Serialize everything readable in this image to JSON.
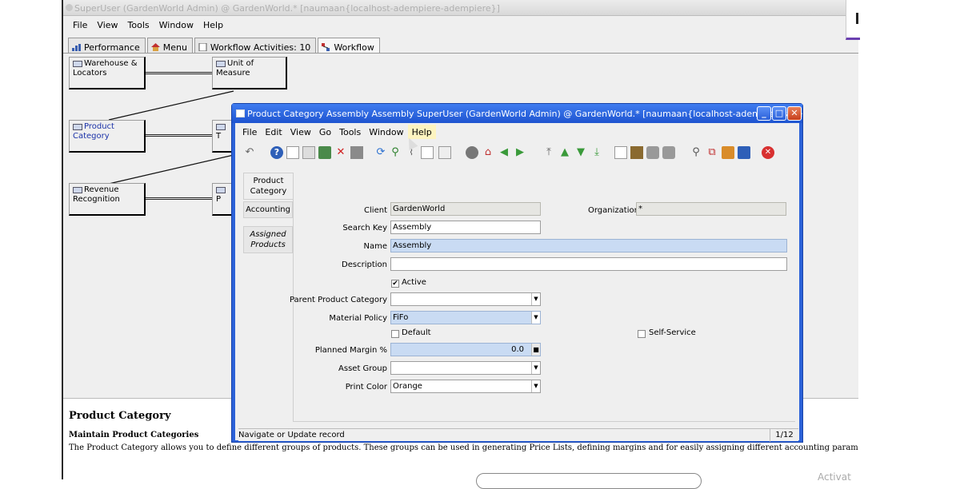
{
  "main_window": {
    "title": "SuperUser  (GardenWorld Admin)  @ GardenWorld.* [naumaan{localhost-adempiere-adempiere}]",
    "menu": [
      "File",
      "View",
      "Tools",
      "Window",
      "Help"
    ],
    "tabs": [
      {
        "label": "Performance",
        "icon": "chart-icon"
      },
      {
        "label": "Menu",
        "icon": "home-icon"
      },
      {
        "label": "Workflow Activities: 10",
        "icon": "document-icon"
      },
      {
        "label": "Workflow",
        "icon": "workflow-icon"
      }
    ]
  },
  "workflow": {
    "nodes": [
      {
        "label": "Warehouse & Locators"
      },
      {
        "label": "Unit of Measure"
      },
      {
        "label": "Product Category"
      },
      {
        "label": "T"
      },
      {
        "label": "Revenue Recognition"
      },
      {
        "label": "P"
      }
    ]
  },
  "help_panel": {
    "title": "Product Category",
    "subtitle": "Maintain Product Categories",
    "text": "The Product Category allows you to define different groups of products.  These groups can be used in generating Price Lists, defining margins and for easily assigning different accounting parameters for products."
  },
  "dialog": {
    "title": "Product Category  Assembly  Assembly  SuperUser  (GardenWorld Admin)  @ GardenWorld.* [naumaan{localhost-adempiere-ade...",
    "menu": [
      "File",
      "Edit",
      "View",
      "Go",
      "Tools",
      "Window",
      "Help"
    ],
    "side_tabs": [
      "Product Category",
      "Accounting",
      "Assigned Products"
    ],
    "fields": {
      "client_label": "Client",
      "client_value": "GardenWorld",
      "organization_label": "Organization",
      "organization_value": "*",
      "search_key_label": "Search Key",
      "search_key_value": "Assembly",
      "name_label": "Name",
      "name_value": "Assembly",
      "description_label": "Description",
      "description_value": "",
      "active_label": "Active",
      "active_checked": true,
      "parent_label": "Parent Product Category",
      "parent_value": "",
      "material_policy_label": "Material Policy",
      "material_policy_value": "FiFo",
      "default_label": "Default",
      "self_service_label": "Self-Service",
      "planned_margin_label": "Planned Margin %",
      "planned_margin_value": "0.0",
      "asset_group_label": "Asset Group",
      "asset_group_value": "",
      "print_color_label": "Print Color",
      "print_color_value": "Orange"
    },
    "status_text": "Navigate or Update record",
    "record_position": "1/12"
  },
  "overlay": {
    "activate_text": "Activat"
  },
  "colors": {
    "dialog_title": "#2c62d8",
    "required_field": "#c9dbf3",
    "readonly_field": "#e6e6e2"
  }
}
